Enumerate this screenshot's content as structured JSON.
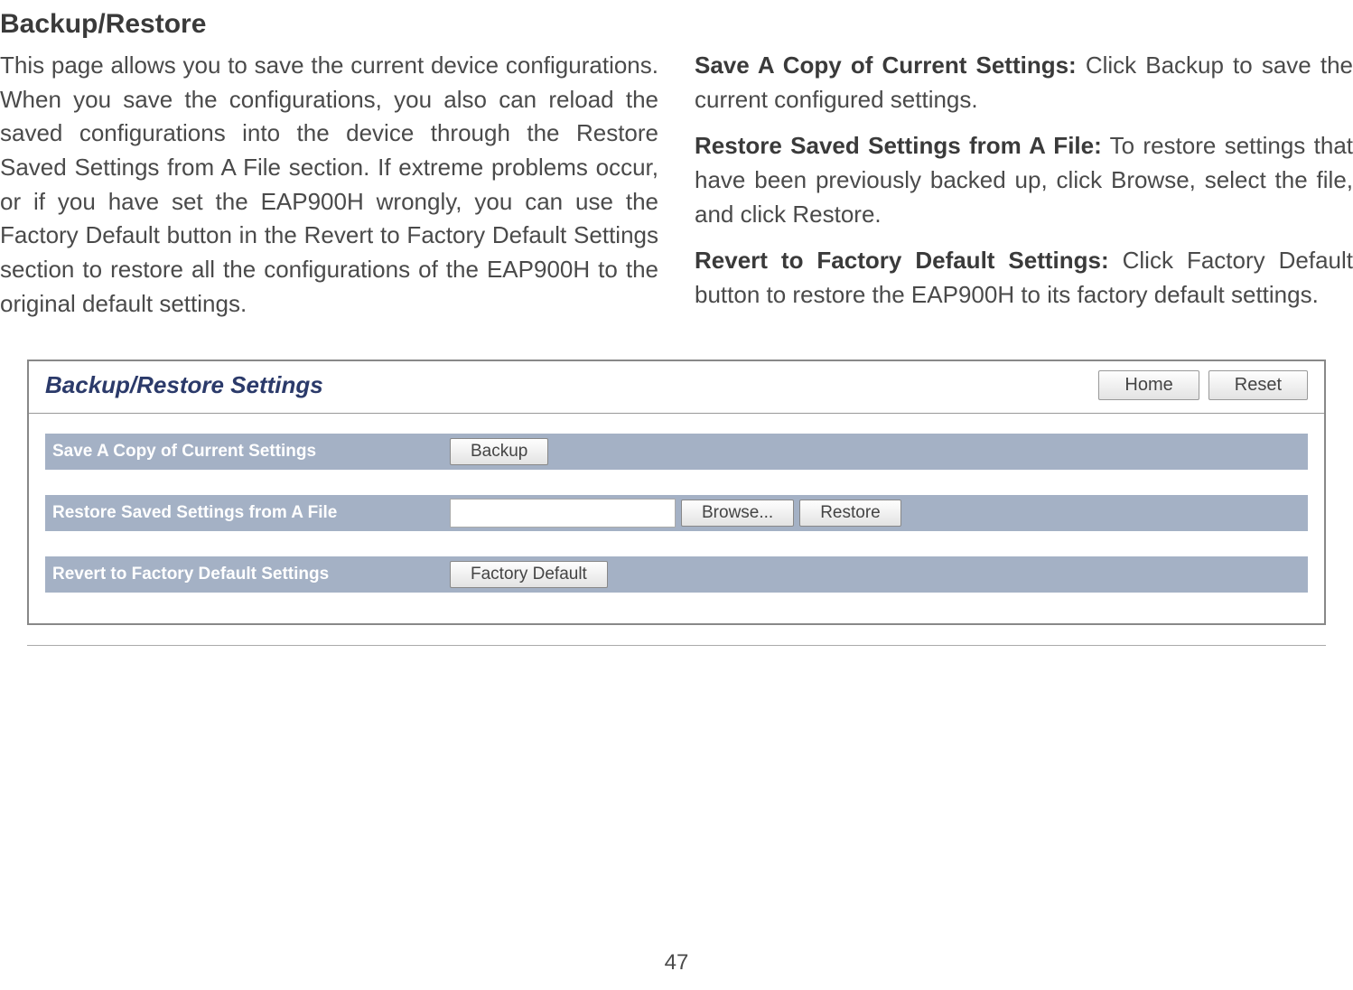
{
  "page_title": "Backup/Restore",
  "col_left": {
    "p1": "This page allows you to save the current device configurations. When you save the configurations, you also can reload the saved configurations into the device through the Restore Saved Settings from A File section. If extreme problems occur, or if you have set the EAP900H wrongly, you can use the Factory Default button in the Revert to Factory Default Settings section to restore all the configurations of the EAP900H to the original default settings."
  },
  "col_right": {
    "save_lead": "Save A Copy of Current Settings:",
    "save_text": " Click Backup to save the current configured settings.",
    "restore_lead": "Restore Saved Settings from A File:",
    "restore_text": " To restore settings that have been previously backed up, click Browse, select the file, and click Restore.",
    "revert_lead": "Revert to Factory Default Settings:",
    "revert_text": " Click Factory Default button to restore the EAP900H to its factory default settings."
  },
  "ui": {
    "panel_title": "Backup/Restore Settings",
    "home_btn": "Home",
    "reset_btn": "Reset",
    "rows": {
      "save": {
        "label": "Save A Copy of Current Settings",
        "btn": "Backup"
      },
      "restore": {
        "label": "Restore Saved Settings from A File",
        "browse_btn": "Browse...",
        "restore_btn": "Restore"
      },
      "revert": {
        "label": "Revert to Factory Default Settings",
        "btn": "Factory Default"
      }
    }
  },
  "page_number": "47"
}
